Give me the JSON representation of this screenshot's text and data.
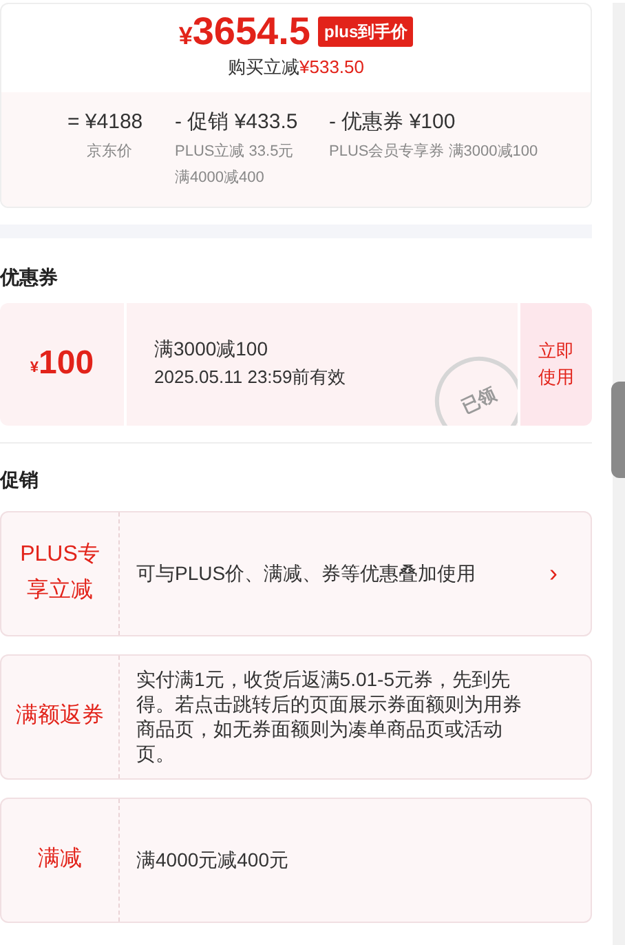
{
  "price": {
    "currency": "¥",
    "amount": "3654.5",
    "badge": "plus到手价",
    "saving_label": "购买立减",
    "saving_amount": "¥533.50"
  },
  "breakdown": [
    {
      "operator": "=",
      "value": "¥4188",
      "notes": [
        "京东价"
      ]
    },
    {
      "operator": "-",
      "label": "促销",
      "value": "¥433.5",
      "notes": [
        "PLUS立减 33.5元",
        "满4000减400"
      ]
    },
    {
      "operator": "-",
      "label": "优惠券",
      "value": "¥100",
      "notes": [
        "PLUS会员专享券 满3000减100"
      ]
    }
  ],
  "coupons": {
    "title": "优惠券",
    "items": [
      {
        "currency": "¥",
        "amount": "100",
        "condition": "满3000减100",
        "validity": "2025.05.11 23:59前有效",
        "action": "立即使用",
        "claimed": true,
        "stamp": "已领"
      }
    ]
  },
  "promotions": {
    "title": "促销",
    "items": [
      {
        "tag": "PLUS专享立减",
        "text": "可与PLUS价、满减、券等优惠叠加使用",
        "arrow": "›"
      },
      {
        "tag": "满额返券",
        "text": "实付满1元，收货后返满5.01-5元券，先到先得。若点击跳转后的页面展示券面额则为用券商品页，如无券面额则为凑单商品页或活动页。"
      },
      {
        "tag": "满减",
        "text": "满4000元减400元"
      }
    ]
  }
}
